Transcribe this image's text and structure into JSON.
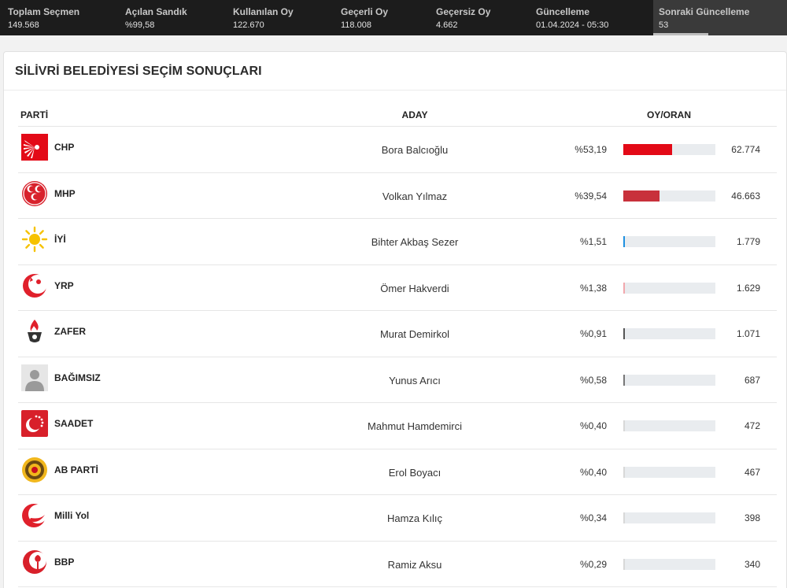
{
  "stats": [
    {
      "label": "Toplam Seçmen",
      "value": "149.568"
    },
    {
      "label": "Açılan Sandık",
      "value": "%99,58"
    },
    {
      "label": "Kullanılan Oy",
      "value": "122.670"
    },
    {
      "label": "Geçerli Oy",
      "value": "118.008"
    },
    {
      "label": "Geçersiz Oy",
      "value": "4.662"
    },
    {
      "label": "Güncelleme",
      "value": "01.04.2024 - 05:30"
    },
    {
      "label": "Sonraki Güncelleme",
      "value": "53"
    }
  ],
  "title": "SİLİVRİ BELEDİYESİ SEÇİM SONUÇLARI",
  "headers": {
    "party": "PARTİ",
    "candidate": "ADAY",
    "vote": "OY/ORAN"
  },
  "rows": [
    {
      "party": "CHP",
      "candidate": "Bora Balcıoğlu",
      "percent": "%53,19",
      "share": 53.19,
      "votes": "62.774",
      "color": "#e30a17",
      "icon": "chp-logo-icon"
    },
    {
      "party": "MHP",
      "candidate": "Volkan Yılmaz",
      "percent": "%39,54",
      "share": 39.54,
      "votes": "46.663",
      "color": "#c8313b",
      "icon": "mhp-logo-icon"
    },
    {
      "party": "İYİ",
      "candidate": "Bihter Akbaş Sezer",
      "percent": "%1,51",
      "share": 1.51,
      "votes": "1.779",
      "color": "#1e90e0",
      "icon": "iyi-sun-logo-icon"
    },
    {
      "party": "YRP",
      "candidate": "Ömer Hakverdi",
      "percent": "%1,38",
      "share": 1.38,
      "votes": "1.629",
      "color": "#f2a7ac",
      "icon": "yrp-logo-icon"
    },
    {
      "party": "ZAFER",
      "candidate": "Murat Demirkol",
      "percent": "%0,91",
      "share": 0.91,
      "votes": "1.071",
      "color": "#555555",
      "icon": "zafer-torch-logo-icon"
    },
    {
      "party": "BAĞIMSIZ",
      "candidate": "Yunus Arıcı",
      "percent": "%0,58",
      "share": 0.58,
      "votes": "687",
      "color": "#777777",
      "icon": "independent-person-icon"
    },
    {
      "party": "SAADET",
      "candidate": "Mahmut Hamdemirci",
      "percent": "%0,40",
      "share": 0.4,
      "votes": "472",
      "color": "#d8d8d8",
      "icon": "saadet-logo-icon"
    },
    {
      "party": "AB PARTİ",
      "candidate": "Erol Boyacı",
      "percent": "%0,40",
      "share": 0.4,
      "votes": "467",
      "color": "#d8d8d8",
      "icon": "ab-parti-logo-icon"
    },
    {
      "party": "Milli Yol",
      "candidate": "Hamza Kılıç",
      "percent": "%0,34",
      "share": 0.34,
      "votes": "398",
      "color": "#d8d8d8",
      "icon": "milli-yol-logo-icon"
    },
    {
      "party": "BBP",
      "candidate": "Ramiz Aksu",
      "percent": "%0,29",
      "share": 0.29,
      "votes": "340",
      "color": "#d8d8d8",
      "icon": "bbp-logo-icon"
    }
  ]
}
